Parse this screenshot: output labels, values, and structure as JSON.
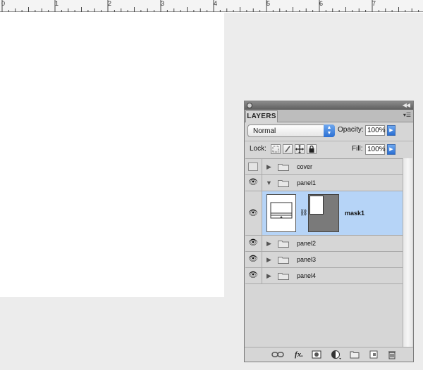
{
  "ruler": {
    "numbers": [
      "0",
      "1",
      "2",
      "3",
      "4",
      "5",
      "6",
      "7"
    ]
  },
  "panel": {
    "tab_label": "LAYERS",
    "collapse_icon": "double-left-arrow-icon",
    "menu_icon": "panel-menu-icon",
    "blend_mode": "Normal",
    "opacity_label": "Opacity:",
    "opacity_value": "100%",
    "lock_label": "Lock:",
    "fill_label": "Fill:",
    "fill_value": "100%"
  },
  "layers": [
    {
      "name": "cover",
      "visible": false,
      "expanded": false,
      "type": "group"
    },
    {
      "name": "panel1",
      "visible": true,
      "expanded": true,
      "type": "group"
    },
    {
      "name": "mask1",
      "visible": true,
      "type": "layer-with-mask",
      "selected": true
    },
    {
      "name": "panel2",
      "visible": true,
      "expanded": false,
      "type": "group"
    },
    {
      "name": "panel3",
      "visible": true,
      "expanded": false,
      "type": "group"
    },
    {
      "name": "panel4",
      "visible": true,
      "expanded": false,
      "type": "group"
    }
  ],
  "bottom_tools": [
    "link-layers-icon",
    "fx-icon",
    "add-mask-icon",
    "adjustment-layer-icon",
    "new-group-icon",
    "new-layer-icon",
    "trash-icon"
  ],
  "bottom_labels": {
    "fx": "fx."
  },
  "colors": {
    "selection": "#b6d4f7",
    "canvas_gray": "#ececec",
    "panel_bg": "#d6d6d6",
    "accent_blue": "#2a6fd3"
  }
}
